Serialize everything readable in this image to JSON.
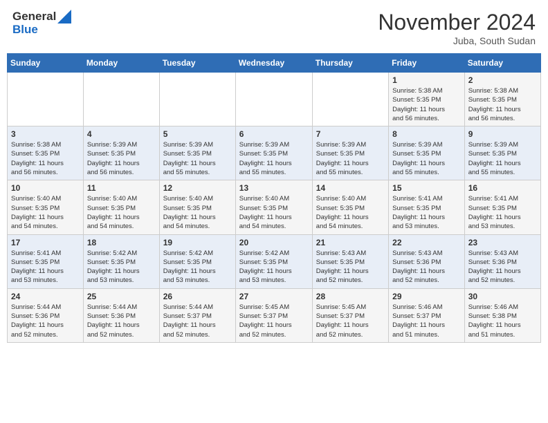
{
  "header": {
    "logo_line1": "General",
    "logo_line2": "Blue",
    "month": "November 2024",
    "location": "Juba, South Sudan"
  },
  "weekdays": [
    "Sunday",
    "Monday",
    "Tuesday",
    "Wednesday",
    "Thursday",
    "Friday",
    "Saturday"
  ],
  "weeks": [
    [
      {
        "day": "",
        "info": ""
      },
      {
        "day": "",
        "info": ""
      },
      {
        "day": "",
        "info": ""
      },
      {
        "day": "",
        "info": ""
      },
      {
        "day": "",
        "info": ""
      },
      {
        "day": "1",
        "info": "Sunrise: 5:38 AM\nSunset: 5:35 PM\nDaylight: 11 hours\nand 56 minutes."
      },
      {
        "day": "2",
        "info": "Sunrise: 5:38 AM\nSunset: 5:35 PM\nDaylight: 11 hours\nand 56 minutes."
      }
    ],
    [
      {
        "day": "3",
        "info": "Sunrise: 5:38 AM\nSunset: 5:35 PM\nDaylight: 11 hours\nand 56 minutes."
      },
      {
        "day": "4",
        "info": "Sunrise: 5:39 AM\nSunset: 5:35 PM\nDaylight: 11 hours\nand 56 minutes."
      },
      {
        "day": "5",
        "info": "Sunrise: 5:39 AM\nSunset: 5:35 PM\nDaylight: 11 hours\nand 55 minutes."
      },
      {
        "day": "6",
        "info": "Sunrise: 5:39 AM\nSunset: 5:35 PM\nDaylight: 11 hours\nand 55 minutes."
      },
      {
        "day": "7",
        "info": "Sunrise: 5:39 AM\nSunset: 5:35 PM\nDaylight: 11 hours\nand 55 minutes."
      },
      {
        "day": "8",
        "info": "Sunrise: 5:39 AM\nSunset: 5:35 PM\nDaylight: 11 hours\nand 55 minutes."
      },
      {
        "day": "9",
        "info": "Sunrise: 5:39 AM\nSunset: 5:35 PM\nDaylight: 11 hours\nand 55 minutes."
      }
    ],
    [
      {
        "day": "10",
        "info": "Sunrise: 5:40 AM\nSunset: 5:35 PM\nDaylight: 11 hours\nand 54 minutes."
      },
      {
        "day": "11",
        "info": "Sunrise: 5:40 AM\nSunset: 5:35 PM\nDaylight: 11 hours\nand 54 minutes."
      },
      {
        "day": "12",
        "info": "Sunrise: 5:40 AM\nSunset: 5:35 PM\nDaylight: 11 hours\nand 54 minutes."
      },
      {
        "day": "13",
        "info": "Sunrise: 5:40 AM\nSunset: 5:35 PM\nDaylight: 11 hours\nand 54 minutes."
      },
      {
        "day": "14",
        "info": "Sunrise: 5:40 AM\nSunset: 5:35 PM\nDaylight: 11 hours\nand 54 minutes."
      },
      {
        "day": "15",
        "info": "Sunrise: 5:41 AM\nSunset: 5:35 PM\nDaylight: 11 hours\nand 53 minutes."
      },
      {
        "day": "16",
        "info": "Sunrise: 5:41 AM\nSunset: 5:35 PM\nDaylight: 11 hours\nand 53 minutes."
      }
    ],
    [
      {
        "day": "17",
        "info": "Sunrise: 5:41 AM\nSunset: 5:35 PM\nDaylight: 11 hours\nand 53 minutes."
      },
      {
        "day": "18",
        "info": "Sunrise: 5:42 AM\nSunset: 5:35 PM\nDaylight: 11 hours\nand 53 minutes."
      },
      {
        "day": "19",
        "info": "Sunrise: 5:42 AM\nSunset: 5:35 PM\nDaylight: 11 hours\nand 53 minutes."
      },
      {
        "day": "20",
        "info": "Sunrise: 5:42 AM\nSunset: 5:35 PM\nDaylight: 11 hours\nand 53 minutes."
      },
      {
        "day": "21",
        "info": "Sunrise: 5:43 AM\nSunset: 5:35 PM\nDaylight: 11 hours\nand 52 minutes."
      },
      {
        "day": "22",
        "info": "Sunrise: 5:43 AM\nSunset: 5:36 PM\nDaylight: 11 hours\nand 52 minutes."
      },
      {
        "day": "23",
        "info": "Sunrise: 5:43 AM\nSunset: 5:36 PM\nDaylight: 11 hours\nand 52 minutes."
      }
    ],
    [
      {
        "day": "24",
        "info": "Sunrise: 5:44 AM\nSunset: 5:36 PM\nDaylight: 11 hours\nand 52 minutes."
      },
      {
        "day": "25",
        "info": "Sunrise: 5:44 AM\nSunset: 5:36 PM\nDaylight: 11 hours\nand 52 minutes."
      },
      {
        "day": "26",
        "info": "Sunrise: 5:44 AM\nSunset: 5:37 PM\nDaylight: 11 hours\nand 52 minutes."
      },
      {
        "day": "27",
        "info": "Sunrise: 5:45 AM\nSunset: 5:37 PM\nDaylight: 11 hours\nand 52 minutes."
      },
      {
        "day": "28",
        "info": "Sunrise: 5:45 AM\nSunset: 5:37 PM\nDaylight: 11 hours\nand 52 minutes."
      },
      {
        "day": "29",
        "info": "Sunrise: 5:46 AM\nSunset: 5:37 PM\nDaylight: 11 hours\nand 51 minutes."
      },
      {
        "day": "30",
        "info": "Sunrise: 5:46 AM\nSunset: 5:38 PM\nDaylight: 11 hours\nand 51 minutes."
      }
    ]
  ]
}
